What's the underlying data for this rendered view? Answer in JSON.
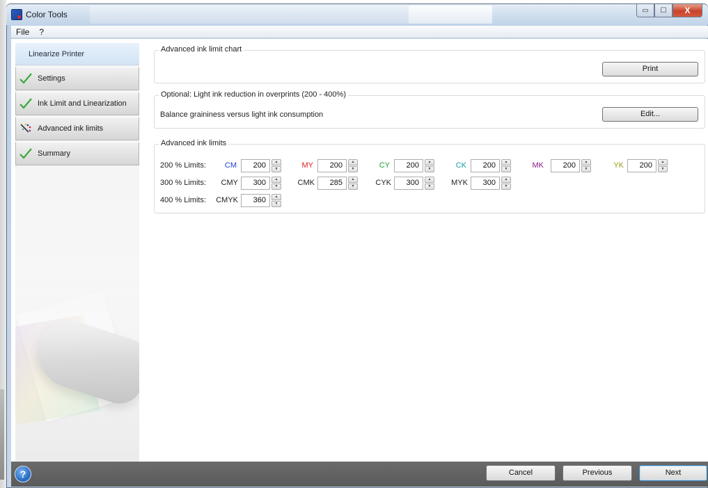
{
  "window": {
    "title": "Color Tools",
    "minimize_glyph": "▭",
    "maximize_glyph": "☐",
    "close_glyph": "X"
  },
  "menu": [
    {
      "label": "File"
    },
    {
      "label": "?"
    }
  ],
  "sidebar": {
    "header": "Linearize Printer",
    "items": [
      {
        "label": "Settings",
        "icon": "green-checkmark-icon"
      },
      {
        "label": "Ink Limit and Linearization",
        "icon": "green-checkmark-icon"
      },
      {
        "label": "Advanced ink limits",
        "icon": "ink-dots-wand-icon"
      },
      {
        "label": "Summary",
        "icon": "green-checkmark-icon"
      }
    ]
  },
  "chart_group": {
    "title": "Advanced ink limit chart",
    "print_button": "Print"
  },
  "light_ink_group": {
    "title": "Optional: Light ink reduction in overprints (200 - 400%)",
    "description": "Balance graininess versus light ink consumption",
    "edit_button": "Edit..."
  },
  "limits_group": {
    "title": "Advanced ink limits",
    "rows": [
      {
        "label": "200 % Limits:",
        "inks": [
          {
            "name": "CM",
            "value": "200",
            "color": "#1f3fcf"
          },
          {
            "name": "MY",
            "value": "200",
            "color": "#e01e1e"
          },
          {
            "name": "CY",
            "value": "200",
            "color": "#1f9a3a"
          },
          {
            "name": "CK",
            "value": "200",
            "color": "#1a9aa8"
          },
          {
            "name": "MK",
            "value": "200",
            "color": "#8a1f8a"
          },
          {
            "name": "YK",
            "value": "200",
            "color": "#9a9a1a"
          }
        ]
      },
      {
        "label": "300 % Limits:",
        "inks": [
          {
            "name": "CMY",
            "value": "300",
            "color": "#1e1e1e"
          },
          {
            "name": "CMK",
            "value": "285",
            "color": "#1e1e1e"
          },
          {
            "name": "CYK",
            "value": "300",
            "color": "#1e1e1e"
          },
          {
            "name": "MYK",
            "value": "300",
            "color": "#1e1e1e"
          }
        ]
      },
      {
        "label": "400 % Limits:",
        "inks": [
          {
            "name": "CMYK",
            "value": "360",
            "color": "#1e1e1e"
          }
        ]
      }
    ]
  },
  "footer": {
    "help_glyph": "?",
    "cancel": "Cancel",
    "previous": "Previous",
    "next": "Next"
  }
}
